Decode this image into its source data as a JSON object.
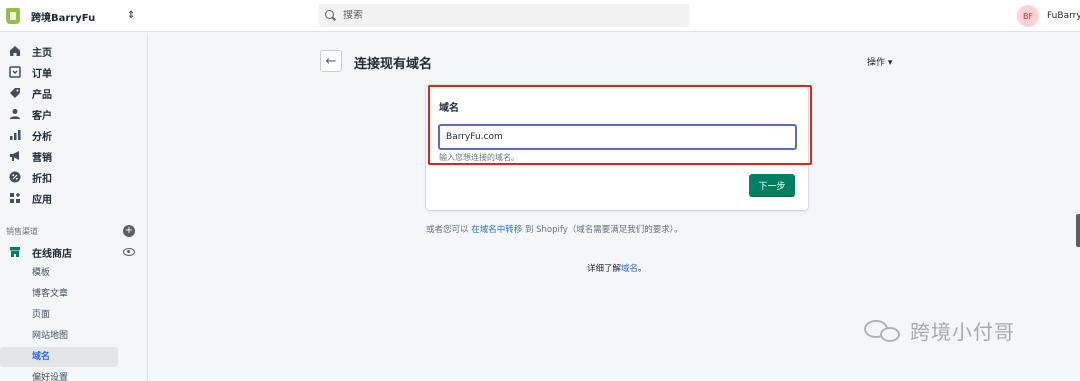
{
  "topbar": {
    "store_name": "跨境BarryFu",
    "switcher_icon": "⇕",
    "search_placeholder": "搜索",
    "user_initials": "BF",
    "user_name": "FuBarry"
  },
  "sidebar": {
    "items": [
      {
        "label": "主页",
        "icon": "home-icon"
      },
      {
        "label": "订单",
        "icon": "orders-icon"
      },
      {
        "label": "产品",
        "icon": "tag-icon"
      },
      {
        "label": "客户",
        "icon": "person-icon"
      },
      {
        "label": "分析",
        "icon": "bar-chart-icon"
      },
      {
        "label": "营销",
        "icon": "megaphone-icon"
      },
      {
        "label": "折扣",
        "icon": "discount-icon"
      },
      {
        "label": "应用",
        "icon": "apps-icon"
      }
    ],
    "sales_channels_title": "销售渠道",
    "online_store_label": "在线商店",
    "sub_items": [
      "模板",
      "博客文章",
      "页面",
      "网站地图",
      "域名",
      "偏好设置"
    ],
    "active_sub_item": "域名"
  },
  "main": {
    "page_title": "连接现有域名",
    "actions_label": "操作 ▾",
    "card_title": "域名",
    "domain_value": "BarryFu.com",
    "help_text": "输入您想连接的域名。",
    "next_button": "下一步",
    "alt_prefix": "或者您可以 ",
    "alt_link": "在域名中转移",
    "alt_suffix": " 到 Shopify（域名需要满足我们的要求）。",
    "more_prefix": "详细了解",
    "more_link": "域名",
    "more_suffix": "。"
  },
  "watermark": {
    "text": "跨境小付哥",
    "icon": "wechat-icon"
  },
  "colors": {
    "primary_button": "#008060",
    "link": "#2c6ecb",
    "highlight_box": "#e0231f",
    "input_focus": "#5c6ac4"
  }
}
